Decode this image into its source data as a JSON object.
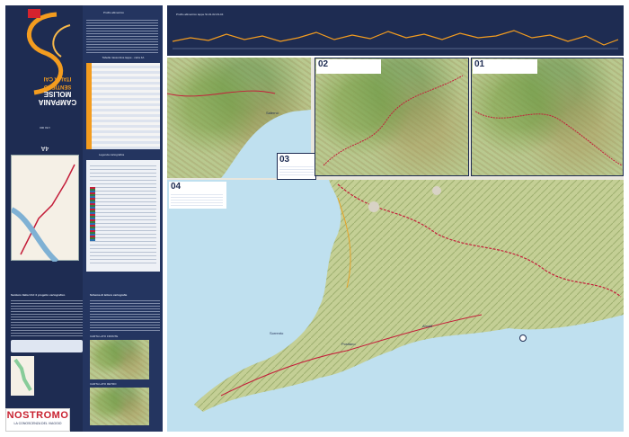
{
  "left_panel": {
    "logo_text": "SENTIERO ITALIA CAI",
    "region_text": "CAMPANIA MOLISE",
    "scale_text": "1:50 000",
    "number_text": "4A",
    "profile_title": "Profilo altimetrico",
    "stages_table_title": "Tabella riassuntiva tappe - carta 4A",
    "legend_title": "Legenda cartografica",
    "project_title": "Sentiero Italia CAI: il progetto cartografico",
    "sheet_title": "Schema di lettura cartografie",
    "inset_title": "CARTA LATO FRONTE",
    "inset_back_title": "CARTA LATO RETRO"
  },
  "top_profile": {
    "title": "Profilo altimetrico tappe SI-01-02-03-04"
  },
  "map_panels": [
    {
      "id": "02"
    },
    {
      "id": "01"
    },
    {
      "id": "03"
    },
    {
      "id": "04"
    }
  ],
  "places": {
    "salerno": "Salerno",
    "sorrento": "Sorrento",
    "positano": "Positano",
    "amalfi": "Amalfi"
  },
  "brand": {
    "name": "NOSTROMO",
    "tagline": "LA CONOSCENZA DEL VIAGGIO"
  },
  "colors": {
    "panel": "#1e2c52",
    "accent": "#f39c1f",
    "sea": "#bfe0ef",
    "brand": "#c8202f"
  }
}
